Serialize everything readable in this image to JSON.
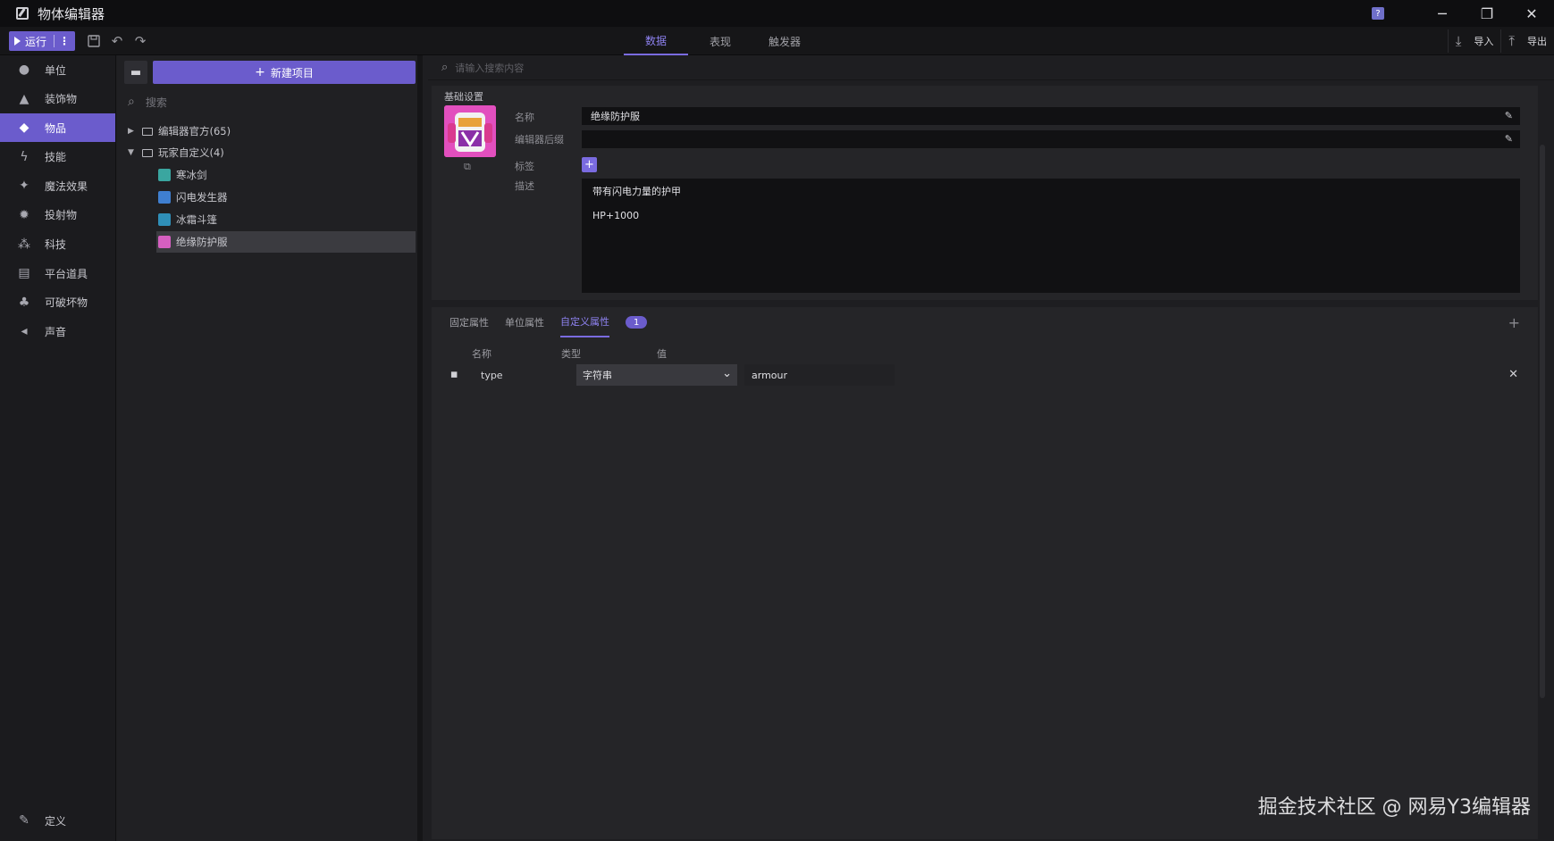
{
  "window": {
    "title": "物体编辑器",
    "help": "?",
    "minimize": "─",
    "restore": "❐",
    "close": "✕"
  },
  "toolbar": {
    "run_label": "运行",
    "more": "⋮",
    "tabs": [
      {
        "label": "数据",
        "active": true
      },
      {
        "label": "表现",
        "active": false
      },
      {
        "label": "触发器",
        "active": false
      }
    ],
    "import_label": "导入",
    "export_label": "导出"
  },
  "sidebar": {
    "items": [
      {
        "label": "单位",
        "icon": "person-icon",
        "active": false
      },
      {
        "label": "装饰物",
        "icon": "tree-icon",
        "active": false
      },
      {
        "label": "物品",
        "icon": "cube-icon",
        "active": true
      },
      {
        "label": "技能",
        "icon": "bolt-icon",
        "active": false
      },
      {
        "label": "魔法效果",
        "icon": "sparkle-icon",
        "active": false
      },
      {
        "label": "投射物",
        "icon": "burst-icon",
        "active": false
      },
      {
        "label": "科技",
        "icon": "molecule-icon",
        "active": false
      },
      {
        "label": "平台道具",
        "icon": "box-icon",
        "active": false
      },
      {
        "label": "可破坏物",
        "icon": "stump-icon",
        "active": false
      },
      {
        "label": "声音",
        "icon": "speaker-icon",
        "active": false
      }
    ],
    "bottom_label": "定义"
  },
  "tree": {
    "new_button": "新建项目",
    "search_placeholder": "搜索",
    "folders": [
      {
        "label": "编辑器官方(65)",
        "expanded": false
      },
      {
        "label": "玩家自定义(4)",
        "expanded": true
      }
    ],
    "items": [
      {
        "label": "寒冰剑",
        "selected": false
      },
      {
        "label": "闪电发生器",
        "selected": false
      },
      {
        "label": "冰霜斗篷",
        "selected": false
      },
      {
        "label": "绝缘防护服",
        "selected": true
      }
    ]
  },
  "content": {
    "search_placeholder": "请输入搜索内容",
    "basic": {
      "section_title": "基础设置",
      "name_label": "名称",
      "name_value": "绝缘防护服",
      "suffix_label": "编辑器后缀",
      "suffix_value": "",
      "tags_label": "标签",
      "desc_label": "描述",
      "desc_lines": [
        "带有闪电力量的护甲",
        "HP+1000"
      ]
    },
    "attributes": {
      "tabs": [
        {
          "label": "固定属性",
          "active": false
        },
        {
          "label": "单位属性",
          "active": false
        },
        {
          "label": "自定义属性",
          "active": true
        }
      ],
      "badge": "1",
      "columns": {
        "name": "名称",
        "type": "类型",
        "value": "值"
      },
      "rows": [
        {
          "name": "type",
          "type": "字符串",
          "value": "armour"
        }
      ]
    }
  },
  "watermark": "掘金技术社区 @ 网易Y3编辑器",
  "colors": {
    "accent": "#6b5ccc",
    "accent_text": "#8e82f0",
    "background": "#1e1e21"
  }
}
